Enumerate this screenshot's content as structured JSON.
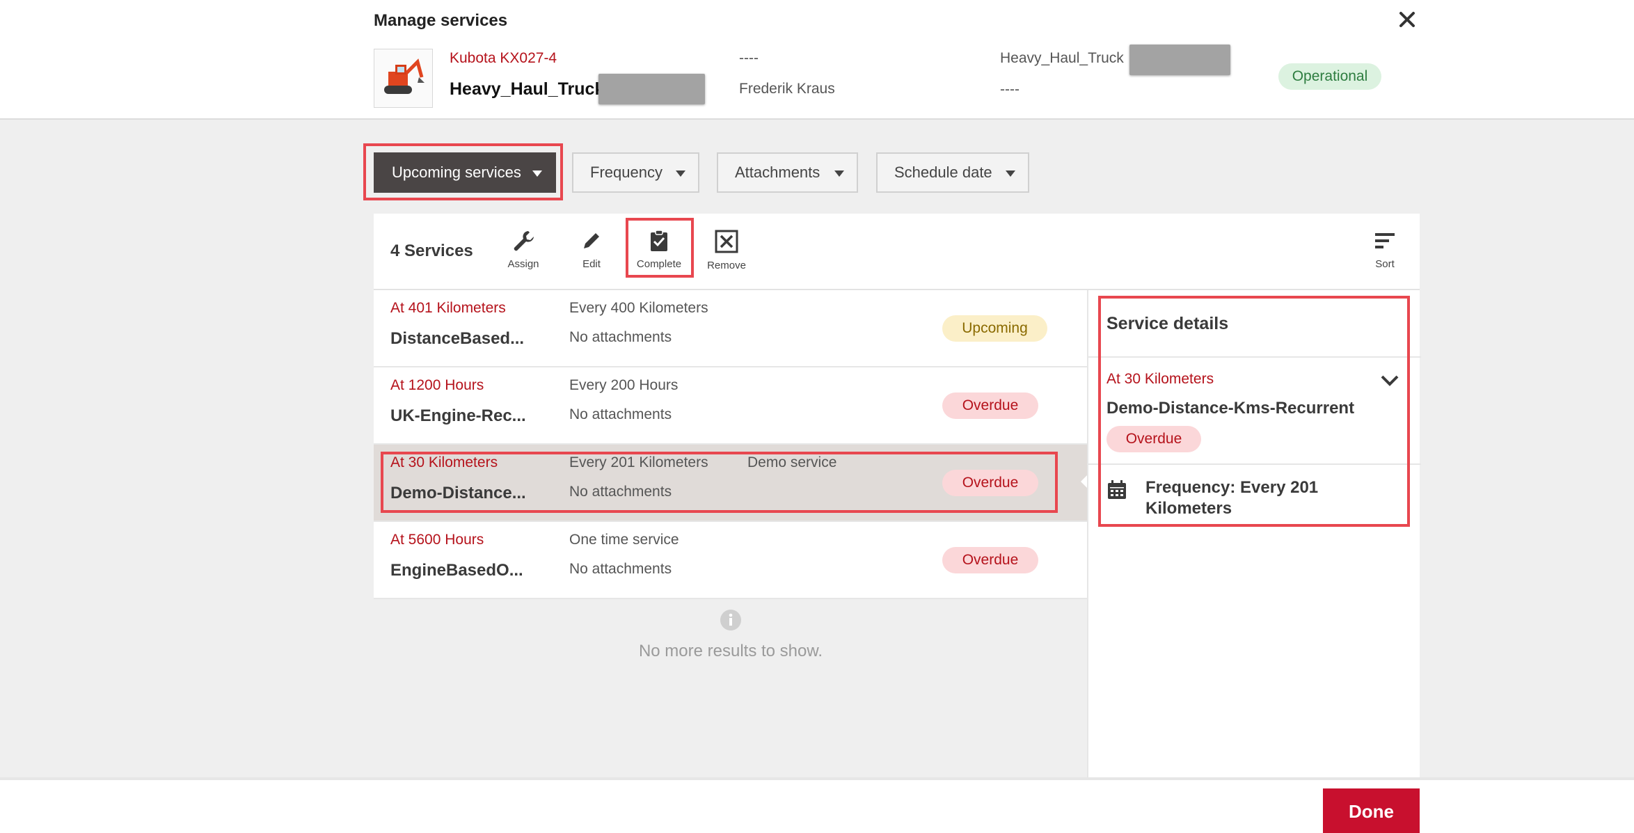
{
  "modal": {
    "title": "Manage services",
    "close_icon": "close-icon"
  },
  "asset": {
    "model": "Kubota KX027-4",
    "name": "Heavy_Haul_Truck",
    "col2_top": "----",
    "col2_bottom": "Frederik Kraus",
    "col3_top": "Heavy_Haul_Truck",
    "col3_bottom": "----",
    "status": "Operational",
    "status_color": "#2e7d40"
  },
  "filters": [
    {
      "label": "Upcoming services",
      "active": true
    },
    {
      "label": "Frequency"
    },
    {
      "label": "Attachments"
    },
    {
      "label": "Schedule date"
    }
  ],
  "toolbar": {
    "count_label": "4 Services",
    "assign_label": "Assign",
    "edit_label": "Edit",
    "complete_label": "Complete",
    "remove_label": "Remove",
    "sort_label": "Sort"
  },
  "services": [
    {
      "when": "At 401 Kilometers",
      "name": "DistanceBased...",
      "frequency": "Every 400 Kilometers",
      "attachments": "No attachments",
      "description": "",
      "status": "Upcoming"
    },
    {
      "when": "At 1200 Hours",
      "name": "UK-Engine-Rec...",
      "frequency": "Every 200 Hours",
      "attachments": "No attachments",
      "description": "",
      "status": "Overdue"
    },
    {
      "when": "At 30 Kilometers",
      "name": "Demo-Distance...",
      "frequency": "Every 201 Kilometers",
      "attachments": "No attachments",
      "description": "Demo service",
      "status": "Overdue",
      "selected": true
    },
    {
      "when": "At 5600 Hours",
      "name": "EngineBasedO...",
      "frequency": "One time service",
      "attachments": "No attachments",
      "description": "",
      "status": "Overdue"
    }
  ],
  "list_end": "No more results to show.",
  "details": {
    "title": "Service details",
    "when": "At 30 Kilometers",
    "name": "Demo-Distance-Kms-Recurrent",
    "status": "Overdue",
    "frequency": "Frequency: Every 201 Kilometers"
  },
  "footer": {
    "done_label": "Done"
  },
  "colors": {
    "accent": "#c8102e",
    "overdue_bg": "#fbd7d9",
    "upcoming_bg": "#fbefc8",
    "highlight": "#e8474f"
  }
}
